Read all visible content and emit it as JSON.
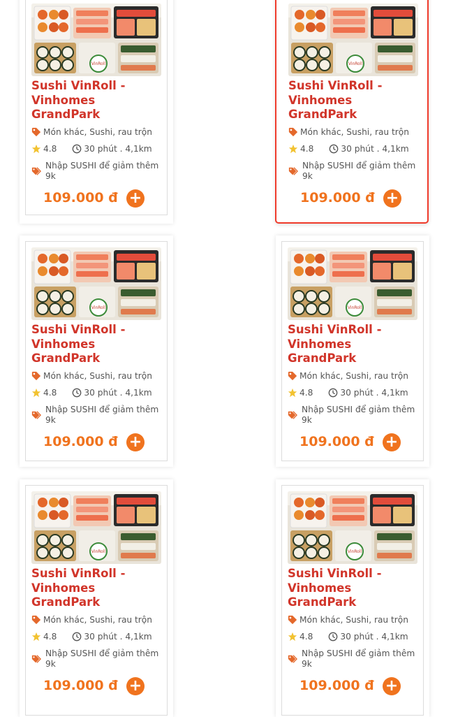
{
  "colors": {
    "title": "#d1352a",
    "price": "#f0731e",
    "add_button": "#f0731e",
    "star": "#f2c230",
    "highlight_border": "#ef3b2b"
  },
  "cards": [
    {
      "name": "Sushi VinRoll - Vinhomes GrandPark",
      "category": "Món khác, Sushi, rau trộn",
      "rating": "4.8",
      "eta_distance": "30 phút . 4,1km",
      "promo": "Nhập SUSHI để giảm thêm 9k",
      "price": "109.000 đ",
      "add_label": "+",
      "image_logo": "VinRoll"
    },
    {
      "name": "Sushi VinRoll - Vinhomes GrandPark",
      "category": "Món khác, Sushi, rau trộn",
      "rating": "4.8",
      "eta_distance": "30 phút . 4,1km",
      "promo": "Nhập SUSHI để giảm thêm 9k",
      "price": "109.000 đ",
      "add_label": "+",
      "image_logo": "VinRoll",
      "highlighted": true
    },
    {
      "name": "Sushi VinRoll - Vinhomes GrandPark",
      "category": "Món khác, Sushi, rau trộn",
      "rating": "4.8",
      "eta_distance": "30 phút . 4,1km",
      "promo": "Nhập SUSHI để giảm thêm 9k",
      "price": "109.000 đ",
      "add_label": "+",
      "image_logo": "VinRoll"
    },
    {
      "name": "Sushi VinRoll - Vinhomes GrandPark",
      "category": "Món khác, Sushi, rau trộn",
      "rating": "4.8",
      "eta_distance": "30 phút . 4,1km",
      "promo": "Nhập SUSHI để giảm thêm 9k",
      "price": "109.000 đ",
      "add_label": "+",
      "image_logo": "VinRoll"
    },
    {
      "name": "Sushi VinRoll - Vinhomes GrandPark",
      "category": "Món khác, Sushi, rau trộn",
      "rating": "4.8",
      "eta_distance": "30 phút . 4,1km",
      "promo": "Nhập SUSHI để giảm thêm 9k",
      "price": "109.000 đ",
      "add_label": "+",
      "image_logo": "VinRoll"
    },
    {
      "name": "Sushi VinRoll - Vinhomes GrandPark",
      "category": "Món khác, Sushi, rau trộn",
      "rating": "4.8",
      "eta_distance": "30 phút . 4,1km",
      "promo": "Nhập SUSHI để giảm thêm 9k",
      "price": "109.000 đ",
      "add_label": "+",
      "image_logo": "VinRoll"
    }
  ]
}
